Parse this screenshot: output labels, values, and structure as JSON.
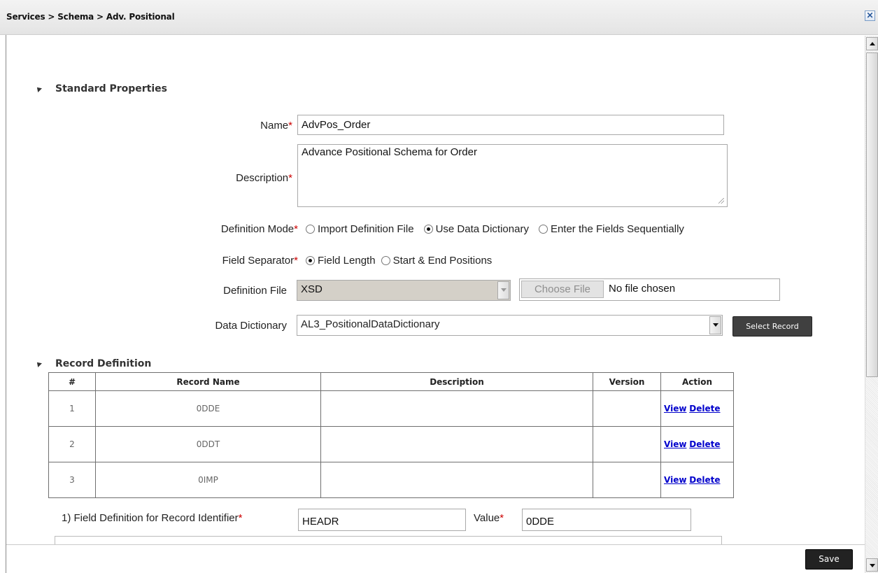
{
  "titlebar": {
    "breadcrumb": "Services > Schema > Adv. Positional",
    "close_icon": "close-icon"
  },
  "standard_properties": {
    "heading": "Standard Properties",
    "name": {
      "label": "Name",
      "required": "*",
      "value": "AdvPos_Order"
    },
    "description": {
      "label": "Description",
      "required": "*",
      "value": "Advance Positional Schema for Order"
    },
    "definition_mode": {
      "label": "Definition Mode",
      "required": "*",
      "options": [
        "Import Definition File",
        "Use Data Dictionary",
        "Enter the Fields Sequentially"
      ],
      "selected": "Use Data Dictionary"
    },
    "field_separator": {
      "label": "Field Separator",
      "required": "*",
      "options": [
        "Field Length",
        "Start & End Positions"
      ],
      "selected": "Field Length"
    },
    "definition_file": {
      "label": "Definition File",
      "type_value": "XSD",
      "choose_label": "Choose File",
      "no_file_text": "No file chosen"
    },
    "data_dictionary": {
      "label": "Data Dictionary",
      "value": "AL3_PositionalDataDictionary",
      "select_record_label": "Select Record"
    }
  },
  "record_definition": {
    "heading": "Record Definition",
    "columns": [
      "#",
      "Record Name",
      "Description",
      "Version",
      "Action"
    ],
    "rows": [
      {
        "num": "1",
        "name": "0DDE",
        "description": "",
        "version": "",
        "view": "View",
        "delete": "Delete"
      },
      {
        "num": "2",
        "name": "0DDT",
        "description": "",
        "version": "",
        "view": "View",
        "delete": "Delete"
      },
      {
        "num": "3",
        "name": "0IMP",
        "description": "",
        "version": "",
        "view": "View",
        "delete": "Delete"
      }
    ]
  },
  "field_definition": {
    "label": "1) Field Definition for Record Identifier",
    "required": "*",
    "identifier_value": "HEADR",
    "value_label": "Value",
    "value_required": "*",
    "value": "0DDE"
  },
  "footer": {
    "save_label": "Save"
  }
}
